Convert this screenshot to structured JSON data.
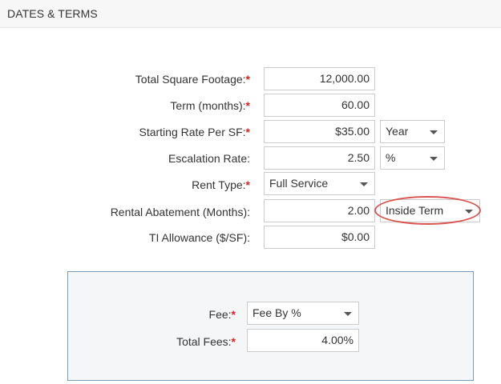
{
  "header": {
    "title": "DATES & TERMS"
  },
  "required_marker": "*",
  "fields": {
    "total_sf": {
      "label": "Total Square Footage:",
      "value": "12,000.00"
    },
    "term": {
      "label": "Term (months):",
      "value": "60.00"
    },
    "starting_rate": {
      "label": "Starting Rate Per SF:",
      "value": "$35.00",
      "unit": "Year"
    },
    "escalation": {
      "label": "Escalation Rate:",
      "value": "2.50",
      "unit": "%"
    },
    "rent_type": {
      "label": "Rent Type:",
      "value": "Full Service"
    },
    "abatement": {
      "label": "Rental Abatement (Months):",
      "value": "2.00",
      "option": "Inside Term"
    },
    "ti_allowance": {
      "label": "TI Allowance ($/SF):",
      "value": "$0.00"
    }
  },
  "fee_panel": {
    "fee": {
      "label": "Fee:",
      "value": "Fee By %"
    },
    "total_fees": {
      "label": "Total Fees:",
      "value": "4.00%"
    }
  },
  "colors": {
    "required": "#e0201d",
    "highlight": "#d9534f",
    "panel_border": "#7d9bb5"
  }
}
